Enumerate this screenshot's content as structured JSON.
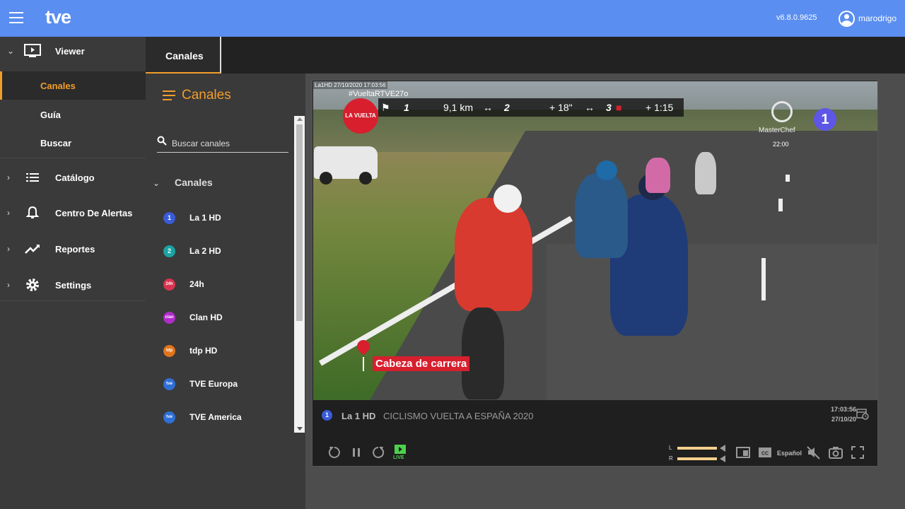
{
  "header": {
    "logo": "tve",
    "version": "v6.8.0.9625",
    "username": "marodrigo"
  },
  "sidebar": {
    "sections": [
      {
        "label": "Viewer",
        "icon": "tv-icon",
        "expanded": true
      },
      {
        "label": "Catálogo",
        "icon": "list-icon",
        "expanded": false
      },
      {
        "label": "Centro De Alertas",
        "icon": "bell-icon",
        "expanded": false
      },
      {
        "label": "Reportes",
        "icon": "trend-icon",
        "expanded": false
      },
      {
        "label": "Settings",
        "icon": "gear-icon",
        "expanded": false
      }
    ],
    "viewer_items": [
      {
        "label": "Canales",
        "active": true
      },
      {
        "label": "Guía",
        "active": false
      },
      {
        "label": "Buscar",
        "active": false
      }
    ]
  },
  "tabs": [
    {
      "label": "Canales",
      "active": true
    }
  ],
  "channels_panel": {
    "title": "Canales",
    "search_placeholder": "Buscar canales",
    "group_label": "Canales",
    "channels": [
      {
        "label": "La 1 HD",
        "badge": "1",
        "color": "#3a5bd9"
      },
      {
        "label": "La 2 HD",
        "badge": "2",
        "color": "#1aa3a3"
      },
      {
        "label": "24h",
        "badge": "24h",
        "color": "#d9334d"
      },
      {
        "label": "Clan HD",
        "badge": "clan",
        "color": "#b02cc9"
      },
      {
        "label": "tdp HD",
        "badge": "tdp",
        "color": "#e2741a"
      },
      {
        "label": "TVE Europa",
        "badge": "tve",
        "color": "#2f6fd6"
      },
      {
        "label": "TVE America",
        "badge": "tve",
        "color": "#2f6fd6"
      }
    ]
  },
  "player": {
    "video_overlay": {
      "stamp": "La1HD  27/10/2020 17:03:56",
      "hashtag": "#VueltaRTVE27o",
      "vuelta_logo": "LA VUELTA",
      "score_pos1": "1",
      "score_dist": "9,1 km",
      "score_pos2": "2",
      "score_gap2": "+ 18\"",
      "score_pos3": "3",
      "score_gap3": "+ 1:15",
      "channel_logo": "1",
      "promo_label": "MasterChef",
      "promo_time": "22:00",
      "caption": "Cabeza de carrera"
    },
    "channel_badge": "1",
    "channel_name": "La 1 HD",
    "program": "CICLISMO VUELTA A ESPAÑA 2020",
    "time": "17:03:56",
    "date": "27/10/20",
    "live_label": "LIVE",
    "vol_left_label": "L",
    "vol_right_label": "R",
    "vol_left": 1.0,
    "vol_right": 1.0,
    "language": "Español"
  },
  "colors": {
    "accent": "#f29d2b",
    "topbar": "#5a8ef0",
    "live": "#4cd14c"
  }
}
